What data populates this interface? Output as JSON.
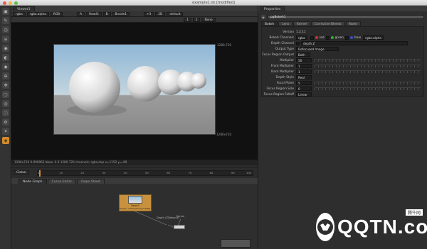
{
  "window": {
    "title": "example1.nk [modified]"
  },
  "viewer": {
    "tab": "Viewer1",
    "channel1": "rgba",
    "channel2": "rgba.alpha",
    "colorspace": "RGB",
    "input_a": "A",
    "input_a_node": "Read3",
    "input_b": "B",
    "input_b_node": "Bnode1",
    "zoom": "+3",
    "view": "2D",
    "lut": "default",
    "gamma": "1",
    "proxy": "None",
    "fstop": "1",
    "format_top": "1280,720",
    "format_bottom": "1280x720",
    "info": "1280x720 0.999963 bbox: 0 0 1280 720 channels: rgba,dep  x=1152 y=-89"
  },
  "playback": {
    "frame": "1",
    "fps_label": "fps",
    "fps": "24"
  },
  "timeline": {
    "mode": "Global",
    "start": "1",
    "end": "100",
    "ticks": [
      "1",
      "10",
      "20",
      "30",
      "40",
      "50",
      "60",
      "70",
      "80",
      "90",
      "100"
    ]
  },
  "nodegraph": {
    "tabs": [
      "Node Graph",
      "Curve Editor",
      "Dope Sheet"
    ],
    "read_node": {
      "title": "Read3",
      "subtitle": "Users/...eexample1/src/1280.exr"
    },
    "dot_labels": [
      "Depth (ZDefocus)",
      "Kernel"
    ]
  },
  "properties": {
    "title": "Properties",
    "node_name": "pgBokeh1",
    "tabs": [
      "Bokeh",
      "Lens",
      "Kernel",
      "Corrective Bleeds",
      "Node"
    ],
    "version_label": "Version",
    "version": "1.2.11",
    "rows": [
      {
        "label": "Bokeh Channels",
        "value": "rgba"
      },
      {
        "label": "Depth Channel",
        "value": "depth.Z"
      },
      {
        "label": "Output Type",
        "value": "Defocused Image"
      },
      {
        "label": "Focus Region Output",
        "value": "Both"
      },
      {
        "label": "Multiplier",
        "value": "50"
      },
      {
        "label": "Front Multiplier",
        "value": "1"
      },
      {
        "label": "Back Multiplier",
        "value": "1"
      },
      {
        "label": "Depth Style",
        "value": "Real"
      },
      {
        "label": "Focal Plane",
        "value": "5"
      },
      {
        "label": "Focus Region Size",
        "value": "0"
      },
      {
        "label": "Focus Region Falloff",
        "value": "Linear"
      }
    ],
    "channel_toggles": [
      "red",
      "green",
      "blue",
      "rgba.alpha"
    ],
    "channel_colors": [
      "#d03030",
      "#30b030",
      "#3050d0"
    ]
  },
  "watermark": {
    "text": "QQTN.com",
    "sub": "腾牛网"
  },
  "colors": {
    "accent": "#d28a2c",
    "node": "#c8913e"
  }
}
